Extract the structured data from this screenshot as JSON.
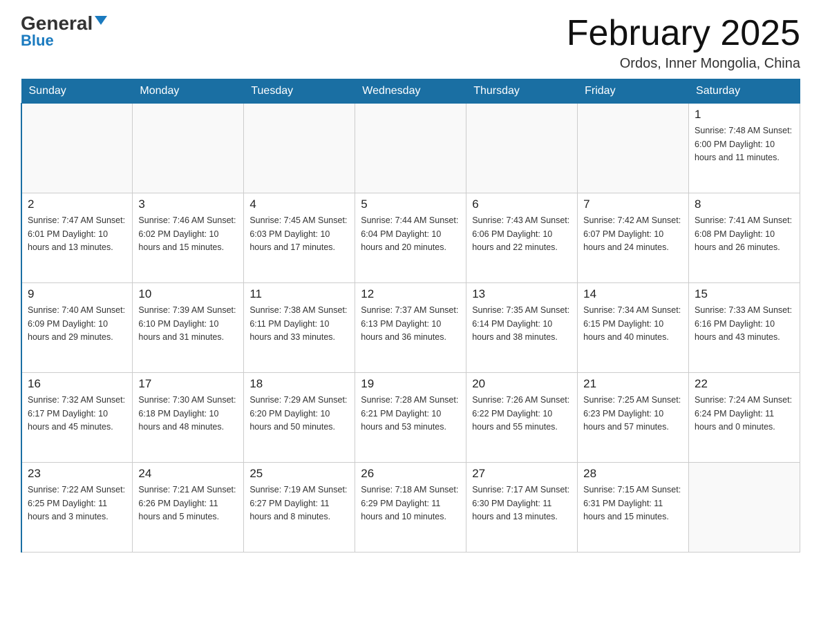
{
  "logo": {
    "general": "General",
    "blue": "Blue",
    "arrow": "▼"
  },
  "title": "February 2025",
  "subtitle": "Ordos, Inner Mongolia, China",
  "days_of_week": [
    "Sunday",
    "Monday",
    "Tuesday",
    "Wednesday",
    "Thursday",
    "Friday",
    "Saturday"
  ],
  "weeks": [
    [
      {
        "day": "",
        "info": ""
      },
      {
        "day": "",
        "info": ""
      },
      {
        "day": "",
        "info": ""
      },
      {
        "day": "",
        "info": ""
      },
      {
        "day": "",
        "info": ""
      },
      {
        "day": "",
        "info": ""
      },
      {
        "day": "1",
        "info": "Sunrise: 7:48 AM\nSunset: 6:00 PM\nDaylight: 10 hours\nand 11 minutes."
      }
    ],
    [
      {
        "day": "2",
        "info": "Sunrise: 7:47 AM\nSunset: 6:01 PM\nDaylight: 10 hours\nand 13 minutes."
      },
      {
        "day": "3",
        "info": "Sunrise: 7:46 AM\nSunset: 6:02 PM\nDaylight: 10 hours\nand 15 minutes."
      },
      {
        "day": "4",
        "info": "Sunrise: 7:45 AM\nSunset: 6:03 PM\nDaylight: 10 hours\nand 17 minutes."
      },
      {
        "day": "5",
        "info": "Sunrise: 7:44 AM\nSunset: 6:04 PM\nDaylight: 10 hours\nand 20 minutes."
      },
      {
        "day": "6",
        "info": "Sunrise: 7:43 AM\nSunset: 6:06 PM\nDaylight: 10 hours\nand 22 minutes."
      },
      {
        "day": "7",
        "info": "Sunrise: 7:42 AM\nSunset: 6:07 PM\nDaylight: 10 hours\nand 24 minutes."
      },
      {
        "day": "8",
        "info": "Sunrise: 7:41 AM\nSunset: 6:08 PM\nDaylight: 10 hours\nand 26 minutes."
      }
    ],
    [
      {
        "day": "9",
        "info": "Sunrise: 7:40 AM\nSunset: 6:09 PM\nDaylight: 10 hours\nand 29 minutes."
      },
      {
        "day": "10",
        "info": "Sunrise: 7:39 AM\nSunset: 6:10 PM\nDaylight: 10 hours\nand 31 minutes."
      },
      {
        "day": "11",
        "info": "Sunrise: 7:38 AM\nSunset: 6:11 PM\nDaylight: 10 hours\nand 33 minutes."
      },
      {
        "day": "12",
        "info": "Sunrise: 7:37 AM\nSunset: 6:13 PM\nDaylight: 10 hours\nand 36 minutes."
      },
      {
        "day": "13",
        "info": "Sunrise: 7:35 AM\nSunset: 6:14 PM\nDaylight: 10 hours\nand 38 minutes."
      },
      {
        "day": "14",
        "info": "Sunrise: 7:34 AM\nSunset: 6:15 PM\nDaylight: 10 hours\nand 40 minutes."
      },
      {
        "day": "15",
        "info": "Sunrise: 7:33 AM\nSunset: 6:16 PM\nDaylight: 10 hours\nand 43 minutes."
      }
    ],
    [
      {
        "day": "16",
        "info": "Sunrise: 7:32 AM\nSunset: 6:17 PM\nDaylight: 10 hours\nand 45 minutes."
      },
      {
        "day": "17",
        "info": "Sunrise: 7:30 AM\nSunset: 6:18 PM\nDaylight: 10 hours\nand 48 minutes."
      },
      {
        "day": "18",
        "info": "Sunrise: 7:29 AM\nSunset: 6:20 PM\nDaylight: 10 hours\nand 50 minutes."
      },
      {
        "day": "19",
        "info": "Sunrise: 7:28 AM\nSunset: 6:21 PM\nDaylight: 10 hours\nand 53 minutes."
      },
      {
        "day": "20",
        "info": "Sunrise: 7:26 AM\nSunset: 6:22 PM\nDaylight: 10 hours\nand 55 minutes."
      },
      {
        "day": "21",
        "info": "Sunrise: 7:25 AM\nSunset: 6:23 PM\nDaylight: 10 hours\nand 57 minutes."
      },
      {
        "day": "22",
        "info": "Sunrise: 7:24 AM\nSunset: 6:24 PM\nDaylight: 11 hours\nand 0 minutes."
      }
    ],
    [
      {
        "day": "23",
        "info": "Sunrise: 7:22 AM\nSunset: 6:25 PM\nDaylight: 11 hours\nand 3 minutes."
      },
      {
        "day": "24",
        "info": "Sunrise: 7:21 AM\nSunset: 6:26 PM\nDaylight: 11 hours\nand 5 minutes."
      },
      {
        "day": "25",
        "info": "Sunrise: 7:19 AM\nSunset: 6:27 PM\nDaylight: 11 hours\nand 8 minutes."
      },
      {
        "day": "26",
        "info": "Sunrise: 7:18 AM\nSunset: 6:29 PM\nDaylight: 11 hours\nand 10 minutes."
      },
      {
        "day": "27",
        "info": "Sunrise: 7:17 AM\nSunset: 6:30 PM\nDaylight: 11 hours\nand 13 minutes."
      },
      {
        "day": "28",
        "info": "Sunrise: 7:15 AM\nSunset: 6:31 PM\nDaylight: 11 hours\nand 15 minutes."
      },
      {
        "day": "",
        "info": ""
      }
    ]
  ]
}
